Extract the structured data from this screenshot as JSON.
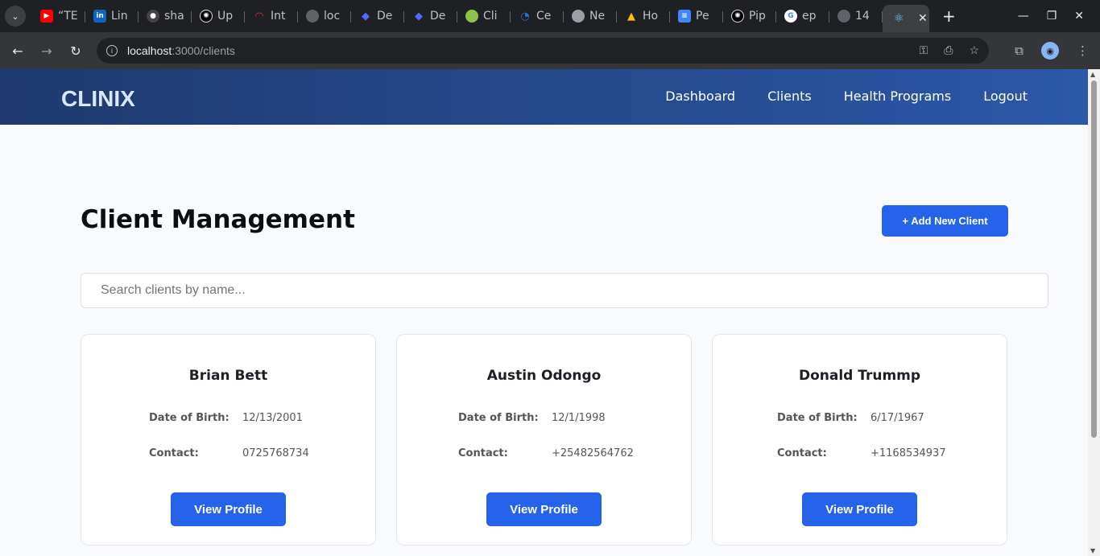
{
  "browser": {
    "tabs": [
      {
        "label": "“TE",
        "icon": "youtube-icon",
        "color": "#ff0000"
      },
      {
        "label": "Lin",
        "icon": "linkedin-icon",
        "color": "#0a66c2"
      },
      {
        "label": "sha",
        "icon": "github-icon",
        "color": "#24292f"
      },
      {
        "label": "Up",
        "icon": "openai-icon",
        "color": "#000000"
      },
      {
        "label": "Int",
        "icon": "gauge-icon",
        "color": "#b3261e"
      },
      {
        "label": "loc",
        "icon": "globe-icon",
        "color": "#5f6368"
      },
      {
        "label": "De",
        "icon": "deepseek-icon",
        "color": "#4d6bfe"
      },
      {
        "label": "De",
        "icon": "deepseek-icon",
        "color": "#4d6bfe"
      },
      {
        "label": "Cli",
        "icon": "globe-green-icon",
        "color": "#4caf50"
      },
      {
        "label": "Ce",
        "icon": "render-icon",
        "color": "#1a73e8"
      },
      {
        "label": "Ne",
        "icon": "chrome-icon",
        "color": "#5f6368"
      },
      {
        "label": "Ho",
        "icon": "drive-icon",
        "color": "#fbbc04"
      },
      {
        "label": "Pe",
        "icon": "docs-icon",
        "color": "#4285f4"
      },
      {
        "label": "Pip",
        "icon": "openai-icon",
        "color": "#000000"
      },
      {
        "label": "ep",
        "icon": "google-icon",
        "color": "#ffffff"
      },
      {
        "label": "14",
        "icon": "globe-icon",
        "color": "#5f6368"
      }
    ],
    "active_tab_icon": "react-icon",
    "url_host": "localhost",
    "url_path": ":3000/clients"
  },
  "navbar": {
    "brand": "CLINIX",
    "links": [
      "Dashboard",
      "Clients",
      "Health Programs",
      "Logout"
    ]
  },
  "page": {
    "title": "Client Management",
    "add_button": "+ Add New Client",
    "search_placeholder": "Search clients by name...",
    "dob_label": "Date of Birth:",
    "contact_label": "Contact:",
    "view_label": "View Profile"
  },
  "clients": [
    {
      "name": "Brian Bett",
      "dob": "12/13/2001",
      "contact": "0725768734"
    },
    {
      "name": "Austin Odongo",
      "dob": "12/1/1998",
      "contact": "+25482564762"
    },
    {
      "name": "Donald Trummp",
      "dob": "6/17/1967",
      "contact": "+1168534937"
    }
  ],
  "colors": {
    "accent": "#2563eb",
    "navbar_start": "#1e3a6e",
    "navbar_end": "#2b58a8"
  }
}
